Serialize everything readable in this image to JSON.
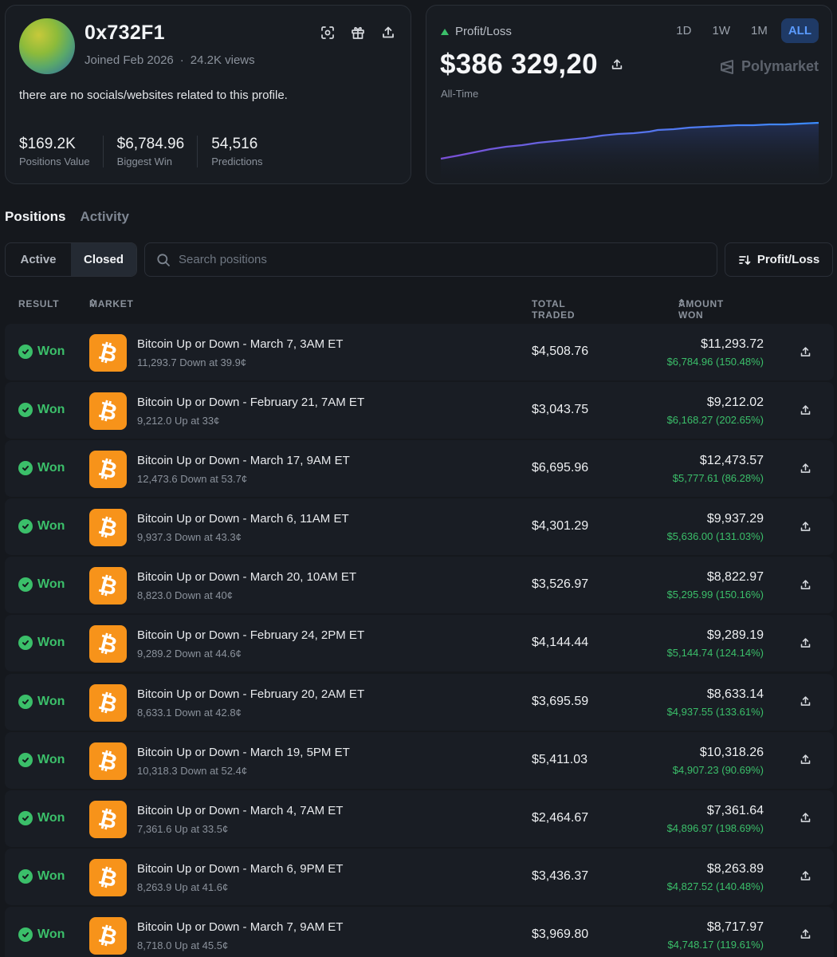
{
  "profile": {
    "username": "0x732F1",
    "joined": "Joined Feb 2026",
    "separator": "·",
    "views": "24.2K views",
    "bio": "there are no socials/websites related to this profile.",
    "stats": [
      {
        "value": "$169.2K",
        "label": "Positions Value"
      },
      {
        "value": "$6,784.96",
        "label": "Biggest Win"
      },
      {
        "value": "54,516",
        "label": "Predictions"
      }
    ],
    "actions": [
      "scan-icon",
      "gift-icon",
      "share-icon"
    ]
  },
  "pnl": {
    "label": "Profit/Loss",
    "value": "$386 329,20",
    "period": "All-Time",
    "ranges": [
      "1D",
      "1W",
      "1M",
      "ALL"
    ],
    "active_range": "ALL",
    "brand": "Polymarket",
    "colors": {
      "line_start": "#7b4fd6",
      "line_end": "#3b8cff",
      "positive": "#3bbf6a"
    }
  },
  "tabs": [
    {
      "label": "Positions",
      "active": true
    },
    {
      "label": "Activity",
      "active": false
    }
  ],
  "filters": {
    "toggle": [
      {
        "label": "Active",
        "active": false
      },
      {
        "label": "Closed",
        "active": true
      }
    ],
    "search_placeholder": "Search positions",
    "sort_label": "Profit/Loss"
  },
  "table": {
    "headers": {
      "result": "RESULT",
      "market": "MARKET",
      "total_traded": "TOTAL TRADED",
      "amount_won": "AMOUNT WON"
    },
    "rows": [
      {
        "result": "Won",
        "market": "Bitcoin Up or Down - March 7, 3AM ET",
        "detail": "11,293.7 Down at 39.9¢",
        "traded": "$4,508.76",
        "amount": "$11,293.72",
        "profit": "$6,784.96 (150.48%)"
      },
      {
        "result": "Won",
        "market": "Bitcoin Up or Down - February 21, 7AM ET",
        "detail": "9,212.0 Up at 33¢",
        "traded": "$3,043.75",
        "amount": "$9,212.02",
        "profit": "$6,168.27 (202.65%)"
      },
      {
        "result": "Won",
        "market": "Bitcoin Up or Down - March 17, 9AM ET",
        "detail": "12,473.6 Down at 53.7¢",
        "traded": "$6,695.96",
        "amount": "$12,473.57",
        "profit": "$5,777.61 (86.28%)"
      },
      {
        "result": "Won",
        "market": "Bitcoin Up or Down - March 6, 11AM ET",
        "detail": "9,937.3 Down at 43.3¢",
        "traded": "$4,301.29",
        "amount": "$9,937.29",
        "profit": "$5,636.00 (131.03%)"
      },
      {
        "result": "Won",
        "market": "Bitcoin Up or Down - March 20, 10AM ET",
        "detail": "8,823.0 Down at 40¢",
        "traded": "$3,526.97",
        "amount": "$8,822.97",
        "profit": "$5,295.99 (150.16%)"
      },
      {
        "result": "Won",
        "market": "Bitcoin Up or Down - February 24, 2PM ET",
        "detail": "9,289.2 Down at 44.6¢",
        "traded": "$4,144.44",
        "amount": "$9,289.19",
        "profit": "$5,144.74 (124.14%)"
      },
      {
        "result": "Won",
        "market": "Bitcoin Up or Down - February 20, 2AM ET",
        "detail": "8,633.1 Down at 42.8¢",
        "traded": "$3,695.59",
        "amount": "$8,633.14",
        "profit": "$4,937.55 (133.61%)"
      },
      {
        "result": "Won",
        "market": "Bitcoin Up or Down - March 19, 5PM ET",
        "detail": "10,318.3 Down at 52.4¢",
        "traded": "$5,411.03",
        "amount": "$10,318.26",
        "profit": "$4,907.23 (90.69%)"
      },
      {
        "result": "Won",
        "market": "Bitcoin Up or Down - March 4, 7AM ET",
        "detail": "7,361.6 Up at 33.5¢",
        "traded": "$2,464.67",
        "amount": "$7,361.64",
        "profit": "$4,896.97 (198.69%)"
      },
      {
        "result": "Won",
        "market": "Bitcoin Up or Down - March 6, 9PM ET",
        "detail": "8,263.9 Up at 41.6¢",
        "traded": "$3,436.37",
        "amount": "$8,263.89",
        "profit": "$4,827.52 (140.48%)"
      },
      {
        "result": "Won",
        "market": "Bitcoin Up or Down - March 7, 9AM ET",
        "detail": "8,718.0 Up at 45.5¢",
        "traded": "$3,969.80",
        "amount": "$8,717.97",
        "profit": "$4,748.17 (119.61%)"
      }
    ]
  }
}
